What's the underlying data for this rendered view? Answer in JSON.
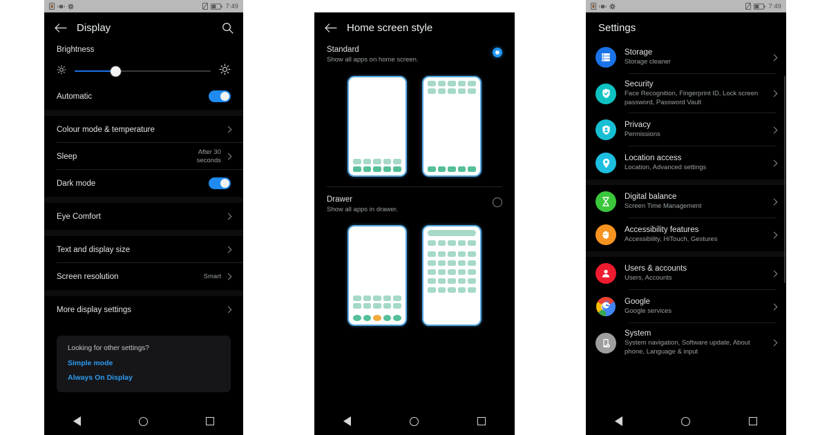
{
  "statusbar": {
    "left_icons": [
      "sim-card-icon",
      "vibrate-icon",
      "settings-gear-icon"
    ],
    "right_icons": [
      "no-sim-icon",
      "battery-icon"
    ],
    "time": "7:49"
  },
  "navbar": {
    "back_label": "Back",
    "home_label": "Home",
    "recents_label": "Recents"
  },
  "display_screen": {
    "title": "Display",
    "back_icon": "arrow-back-icon",
    "search_icon": "search-icon",
    "brightness": {
      "label": "Brightness",
      "low_icon": "brightness-low-icon",
      "high_icon": "brightness-high-icon",
      "value_percent": 30
    },
    "rows": [
      {
        "label": "Automatic",
        "type": "toggle",
        "toggle_on": true
      },
      {
        "label": "Colour mode & temperature",
        "type": "chevron",
        "value": ""
      },
      {
        "label": "Sleep",
        "type": "chevron",
        "value": "After 30 seconds"
      },
      {
        "label": "Dark mode",
        "type": "toggle",
        "toggle_on": true
      },
      {
        "label": "Eye Comfort",
        "type": "chevron",
        "value": ""
      },
      {
        "label": "Text and display size",
        "type": "chevron",
        "value": ""
      },
      {
        "label": "Screen resolution",
        "type": "chevron",
        "value": "Smart"
      },
      {
        "label": "More display settings",
        "type": "chevron",
        "value": ""
      }
    ],
    "info_card": {
      "question": "Looking for other settings?",
      "links": [
        "Simple mode",
        "Always On Display"
      ]
    }
  },
  "home_style_screen": {
    "title": "Home screen style",
    "back_icon": "arrow-back-icon",
    "options": [
      {
        "title": "Standard",
        "subtitle": "Show all apps on home screen.",
        "selected": true
      },
      {
        "title": "Drawer",
        "subtitle": "Show all apps in drawer.",
        "selected": false
      }
    ]
  },
  "settings_screen": {
    "title": "Settings",
    "groups": [
      {
        "items": [
          {
            "title": "Storage",
            "subtitle": "Storage cleaner",
            "icon": "storage-icon",
            "icon_color": "#1a73e8"
          },
          {
            "title": "Security",
            "subtitle": "Face Recognition, Fingerprint ID, Lock screen password, Password Vault",
            "icon": "shield-check-icon",
            "icon_color": "#0ec2c2"
          },
          {
            "title": "Privacy",
            "subtitle": "Permissions",
            "icon": "privacy-shield-icon",
            "icon_color": "#17bfd4"
          },
          {
            "title": "Location access",
            "subtitle": "Location, Advanced settings",
            "icon": "location-pin-icon",
            "icon_color": "#1cbfe0"
          }
        ]
      },
      {
        "items": [
          {
            "title": "Digital balance",
            "subtitle": "Screen Time Management",
            "icon": "hourglass-icon",
            "icon_color": "#3bc73b"
          },
          {
            "title": "Accessibility features",
            "subtitle": "Accessibility, HiTouch, Gestures",
            "icon": "hand-icon",
            "icon_color": "#f79421"
          }
        ]
      },
      {
        "items": [
          {
            "title": "Users & accounts",
            "subtitle": "Users, Accounts",
            "icon": "person-icon",
            "icon_color": "#ef1b2e"
          },
          {
            "title": "Google",
            "subtitle": "Google services",
            "icon": "google-icon",
            "icon_color": "#ffffff"
          },
          {
            "title": "System",
            "subtitle": "System navigation, Software update, About phone, Language & input",
            "icon": "phone-gear-icon",
            "icon_color": "#9e9e9e"
          }
        ]
      }
    ]
  },
  "theme": {
    "background": "#000000",
    "page_background": "#ffffff",
    "accent_blue": "#1f8bf0",
    "link_blue": "#2e9bf0",
    "statusbar_bg": "#b9b9b9",
    "app_tile": "#a6d9c7",
    "app_tile_dark": "#55bf9a",
    "app_tile_accent": "#f0a93c",
    "phone_border": "#56a8e3"
  }
}
